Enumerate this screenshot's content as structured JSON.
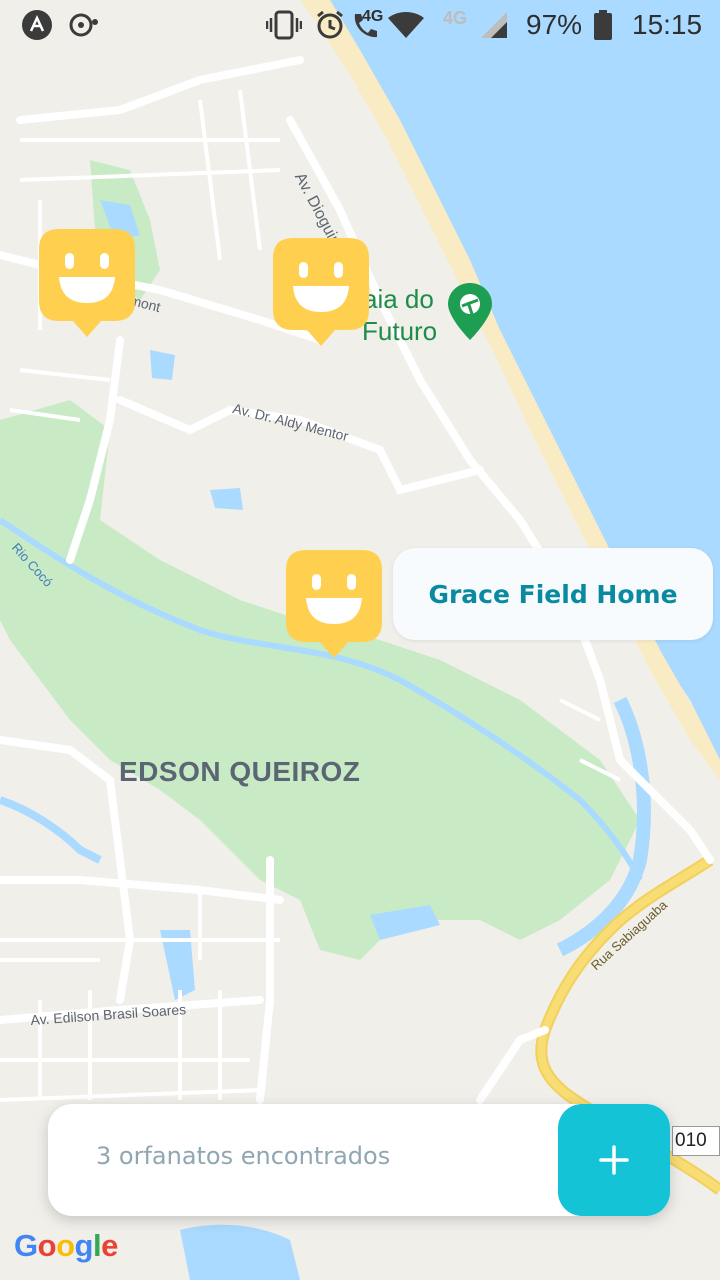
{
  "status_bar": {
    "network": "4G",
    "network_secondary": "4G",
    "battery": "97%",
    "time": "15:15"
  },
  "map": {
    "labels": {
      "street_dioguinho": "Av. Dioguinho",
      "street_aldy_mentor": "Av. Dr. Aldy Mentor",
      "street_edilson": "Av. Edilson Brasil Soares",
      "street_sabiaguaba": "Rua Sabiaguaba",
      "river": "Rio Cocó",
      "street_partial": "mont",
      "poi_line1": "aia do",
      "poi_line2": "Futuro",
      "neighborhood": "EDSON QUEIROZ",
      "road_badge": "010",
      "google": "Google"
    },
    "colors": {
      "water": "#aadaff",
      "park": "#c8ebc6",
      "land": "#f1efea",
      "road": "#ffffff",
      "highway": "#f8dc74",
      "beach": "#f9ecc4"
    }
  },
  "markers": [
    {
      "name": "orphanage-marker-1"
    },
    {
      "name": "orphanage-marker-2"
    },
    {
      "name": "orphanage-marker-3"
    }
  ],
  "callout": {
    "title": "Grace Field Home"
  },
  "footer": {
    "text": "3 orfanatos encontrados",
    "add_icon": "plus-icon",
    "accent": "#15c3d6"
  }
}
